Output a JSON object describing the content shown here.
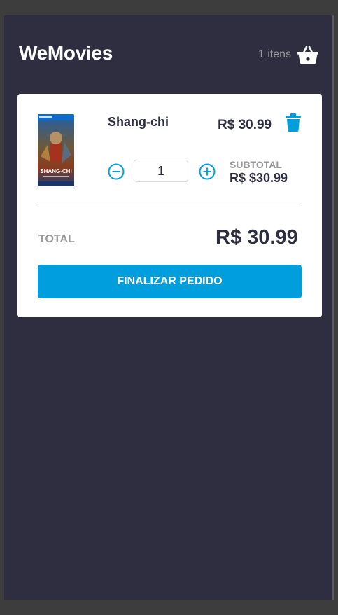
{
  "header": {
    "brand": "WeMovies",
    "cart_count": "1 itens",
    "cart_icon": "basket-icon"
  },
  "cart": {
    "items": [
      {
        "title": "Shang-chi",
        "price": "R$ 30.99",
        "quantity": "1",
        "subtotal_label": "SUBTOTAL",
        "subtotal": "R$ $30.99",
        "cover_title": "SHANG-CHI"
      }
    ],
    "total_label": "TOTAL",
    "total": "R$ 30.99",
    "checkout_label": "FINALIZAR PEDIDO"
  },
  "colors": {
    "background": "#2f2e41",
    "accent": "#009edd",
    "text_dark": "#2f2e41",
    "text_muted": "#999999"
  }
}
